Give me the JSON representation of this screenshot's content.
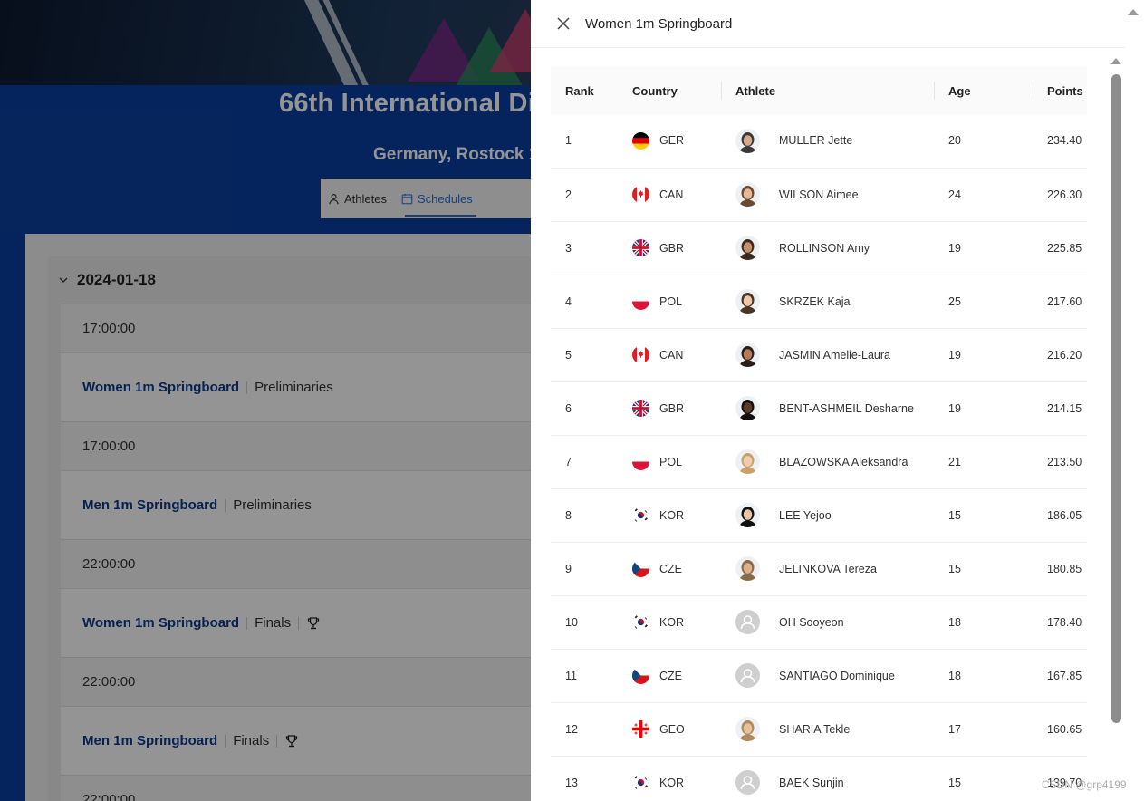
{
  "background": {
    "event_title": "66th International Di",
    "event_subtitle": "Germany, Rostock 1",
    "tabs": [
      {
        "label": "Athletes",
        "icon": "user-icon",
        "active": false
      },
      {
        "label": "Schedules",
        "icon": "calendar-icon",
        "active": true
      }
    ],
    "date": "2024-01-18",
    "schedule": [
      {
        "time": "17:00:00",
        "event": "Women 1m Springboard",
        "phase": "Preliminaries",
        "trophy": false
      },
      {
        "time": "17:00:00",
        "event": "Men 1m Springboard",
        "phase": "Preliminaries",
        "trophy": false
      },
      {
        "time": "22:00:00",
        "event": "Women 1m Springboard",
        "phase": "Finals",
        "trophy": true
      },
      {
        "time": "22:00:00",
        "event": "Men 1m Springboard",
        "phase": "Finals",
        "trophy": true
      },
      {
        "time": "22:00:00",
        "event": "",
        "phase": "",
        "trophy": false
      }
    ]
  },
  "drawer": {
    "title": "Women 1m Springboard",
    "columns": [
      "Rank",
      "Country",
      "Athlete",
      "Age",
      "Points"
    ],
    "rows": [
      {
        "rank": "1",
        "country": "GER",
        "athlete": "MULLER Jette",
        "age": "20",
        "points": "234.40",
        "avatar": "photo"
      },
      {
        "rank": "2",
        "country": "CAN",
        "athlete": "WILSON Aimee",
        "age": "24",
        "points": "226.30",
        "avatar": "photo"
      },
      {
        "rank": "3",
        "country": "GBR",
        "athlete": "ROLLINSON Amy",
        "age": "19",
        "points": "225.85",
        "avatar": "photo"
      },
      {
        "rank": "4",
        "country": "POL",
        "athlete": "SKRZEK Kaja",
        "age": "25",
        "points": "217.60",
        "avatar": "photo"
      },
      {
        "rank": "5",
        "country": "CAN",
        "athlete": "JASMIN Amelie-Laura",
        "age": "19",
        "points": "216.20",
        "avatar": "photo"
      },
      {
        "rank": "6",
        "country": "GBR",
        "athlete": "BENT-ASHMEIL Desharne",
        "age": "19",
        "points": "214.15",
        "avatar": "photo"
      },
      {
        "rank": "7",
        "country": "POL",
        "athlete": "BLAZOWSKA Aleksandra",
        "age": "21",
        "points": "213.50",
        "avatar": "photo"
      },
      {
        "rank": "8",
        "country": "KOR",
        "athlete": "LEE Yejoo",
        "age": "15",
        "points": "186.05",
        "avatar": "photo"
      },
      {
        "rank": "9",
        "country": "CZE",
        "athlete": "JELINKOVA Tereza",
        "age": "15",
        "points": "180.85",
        "avatar": "photo"
      },
      {
        "rank": "10",
        "country": "KOR",
        "athlete": "OH Sooyeon",
        "age": "18",
        "points": "178.40",
        "avatar": "placeholder"
      },
      {
        "rank": "11",
        "country": "CZE",
        "athlete": "SANTIAGO Dominique",
        "age": "18",
        "points": "167.85",
        "avatar": "placeholder"
      },
      {
        "rank": "12",
        "country": "GEO",
        "athlete": "SHARIA Tekle",
        "age": "17",
        "points": "160.65",
        "avatar": "photo"
      },
      {
        "rank": "13",
        "country": "KOR",
        "athlete": "BAEK Sunjin",
        "age": "15",
        "points": "139.70",
        "avatar": "placeholder"
      }
    ]
  },
  "watermark": "CSDN @grp4199",
  "colors": {
    "page_blue": "#0a3fa0",
    "event_link": "#0d3a8c",
    "active_tab": "#2d6fd6"
  }
}
